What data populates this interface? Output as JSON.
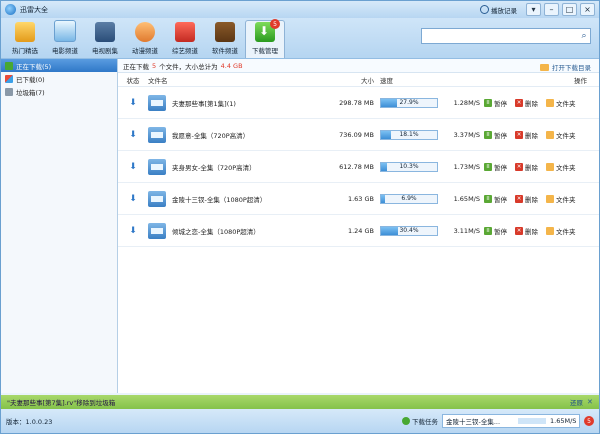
{
  "window": {
    "title": "迅雷大全",
    "history_label": "播放记录"
  },
  "toolbar": {
    "tabs": [
      {
        "label": "热门精选"
      },
      {
        "label": "电影频道"
      },
      {
        "label": "电视剧集"
      },
      {
        "label": "动漫频道"
      },
      {
        "label": "综艺频道"
      },
      {
        "label": "软件频道"
      },
      {
        "label": "下载管理",
        "badge": "5"
      }
    ],
    "search_value": ""
  },
  "sidebar": {
    "items": [
      {
        "label": "正在下载(5)"
      },
      {
        "label": "已下载(0)"
      },
      {
        "label": "垃圾箱(7)"
      }
    ]
  },
  "summary": {
    "prefix": "正在下载",
    "count": "5",
    "suffix": "个文件，大小总计为",
    "total": "4.4 GB",
    "open_dir": "打开下载目录"
  },
  "table": {
    "headers": {
      "status": "状态",
      "file": "文件名",
      "size": "大小",
      "speed": "速度",
      "ops": "操作"
    },
    "ops": {
      "pause": "暂停",
      "delete": "删除",
      "folder": "文件夹"
    },
    "rows": [
      {
        "name": "夫妻那些事[第1集](1)",
        "size": "298.78 MB",
        "progress": "27.9%",
        "fraction": 0.279,
        "speed": "1.28M/S"
      },
      {
        "name": "我愿意-全集（720P高清）",
        "size": "736.09 MB",
        "progress": "18.1%",
        "fraction": 0.181,
        "speed": "3.37M/S"
      },
      {
        "name": "夹身男女-全集（720P高清）",
        "size": "612.78 MB",
        "progress": "10.3%",
        "fraction": 0.103,
        "speed": "1.73M/S"
      },
      {
        "name": "金陵十三钗-全集（1080P超清）",
        "size": "1.63 GB",
        "progress": "6.9%",
        "fraction": 0.069,
        "speed": "1.65M/S"
      },
      {
        "name": "倾城之恋-全集（1080P超清）",
        "size": "1.24 GB",
        "progress": "30.4%",
        "fraction": 0.304,
        "speed": "3.11M/S"
      }
    ]
  },
  "notice": {
    "text": "\"夫妻那些事[第7集].rv\"移除到垃圾箱",
    "action": "还原"
  },
  "status": {
    "version": "版本：1.0.0.23",
    "task_label": "下载任务",
    "mini_name": "金陵十三钗-全集...",
    "mini_speed": "1.65M/S",
    "count": "5"
  }
}
